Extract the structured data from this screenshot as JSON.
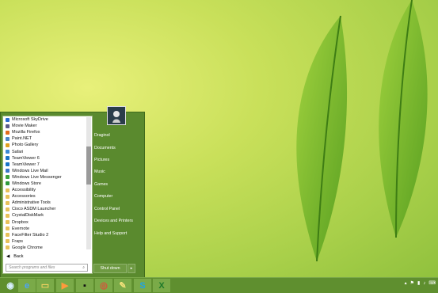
{
  "start_menu": {
    "programs": [
      {
        "label": "Microsoft SkyDrive",
        "icon": "skydrive-icon",
        "color": "#2a6bd1"
      },
      {
        "label": "Movie Maker",
        "icon": "movie-maker-icon",
        "color": "#5a5a8a"
      },
      {
        "label": "Mozilla Firefox",
        "icon": "firefox-icon",
        "color": "#e46c1d"
      },
      {
        "label": "Paint.NET",
        "icon": "paint-net-icon",
        "color": "#4d86c7"
      },
      {
        "label": "Photo Gallery",
        "icon": "photo-gallery-icon",
        "color": "#e0a020"
      },
      {
        "label": "Safari",
        "icon": "safari-icon",
        "color": "#3b8ad8"
      },
      {
        "label": "TeamViewer 6",
        "icon": "teamviewer-icon",
        "color": "#1a73c8"
      },
      {
        "label": "TeamViewer 7",
        "icon": "teamviewer-icon",
        "color": "#1a73c8"
      },
      {
        "label": "Windows Live Mail",
        "icon": "mail-icon",
        "color": "#3b77c7"
      },
      {
        "label": "Windows Live Messenger",
        "icon": "messenger-icon",
        "color": "#3ca23c"
      },
      {
        "label": "Windows Store",
        "icon": "store-icon",
        "color": "#2f9a3a"
      },
      {
        "label": "Accessibility",
        "icon": "folder-icon",
        "color": "#e8c15a"
      },
      {
        "label": "Accessories",
        "icon": "folder-icon",
        "color": "#e8c15a"
      },
      {
        "label": "Administrative Tools",
        "icon": "folder-icon",
        "color": "#e8c15a"
      },
      {
        "label": "Cisco ASDM Launcher",
        "icon": "folder-icon",
        "color": "#e8c15a"
      },
      {
        "label": "CrystalDiskMark",
        "icon": "folder-icon",
        "color": "#e8c15a"
      },
      {
        "label": "Dropbox",
        "icon": "folder-icon",
        "color": "#e8c15a"
      },
      {
        "label": "Evernote",
        "icon": "folder-icon",
        "color": "#e8c15a"
      },
      {
        "label": "FaceFilter Studio 2",
        "icon": "folder-icon",
        "color": "#e8c15a"
      },
      {
        "label": "Fraps",
        "icon": "folder-icon",
        "color": "#e8c15a"
      },
      {
        "label": "Google Chrome",
        "icon": "folder-icon",
        "color": "#e8c15a"
      }
    ],
    "back_label": "Back",
    "search_placeholder": "Search programs and files",
    "places": [
      "Draginol",
      "Documents",
      "Pictures",
      "Music",
      "Games",
      "Computer",
      "Control Panel",
      "Devices and Printers",
      "Help and Support"
    ],
    "shutdown_label": "Shut down"
  },
  "taskbar": {
    "apps": [
      {
        "name": "start-button",
        "icon": "windows-orb-icon"
      },
      {
        "name": "taskbar-ie",
        "icon": "internet-explorer-icon"
      },
      {
        "name": "taskbar-explorer",
        "icon": "folder-icon"
      },
      {
        "name": "taskbar-media",
        "icon": "media-player-icon"
      },
      {
        "name": "taskbar-cmd",
        "icon": "command-prompt-icon"
      },
      {
        "name": "taskbar-chrome",
        "icon": "chrome-icon"
      },
      {
        "name": "taskbar-paint",
        "icon": "paint-icon"
      },
      {
        "name": "taskbar-skype",
        "icon": "skype-icon"
      },
      {
        "name": "taskbar-excel",
        "icon": "excel-icon"
      }
    ]
  }
}
